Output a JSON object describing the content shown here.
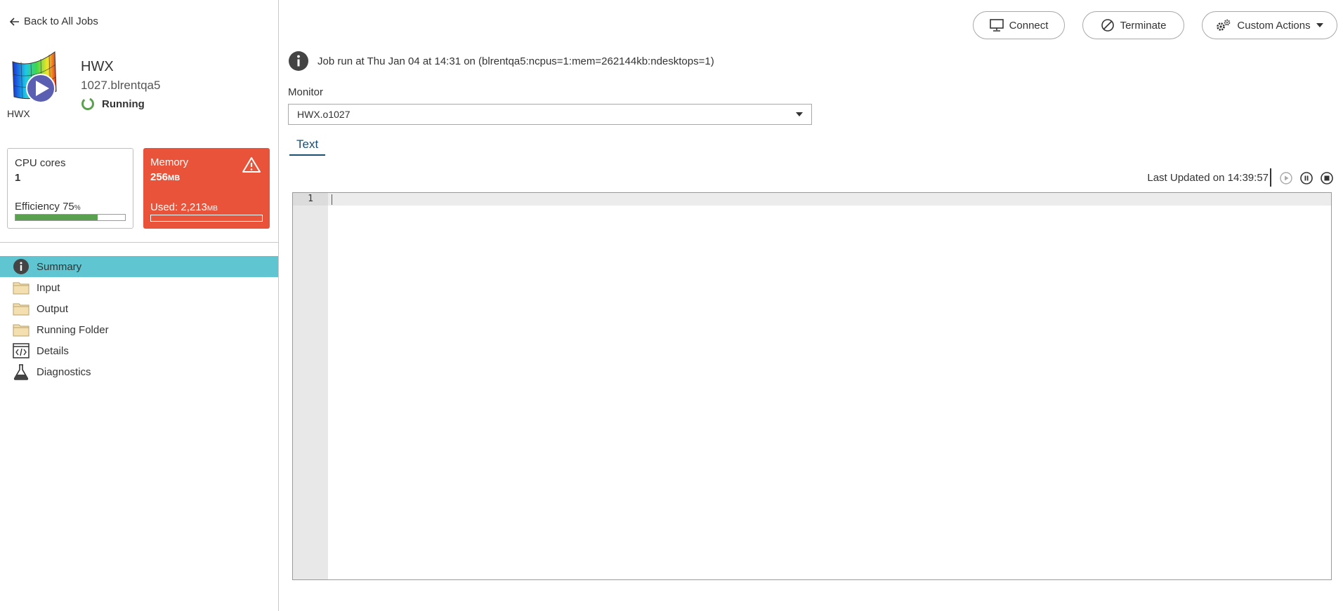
{
  "sidebar": {
    "back_label": "Back to All Jobs",
    "app_label": "HWX",
    "job_title": "HWX",
    "job_id": "1027.blrentqa5",
    "status": "Running",
    "cpu": {
      "label": "CPU cores",
      "value": "1",
      "efficiency_label": "Efficiency 75",
      "efficiency_unit": "%",
      "efficiency_fraction": 0.75
    },
    "memory": {
      "label": "Memory",
      "value": "256",
      "unit": "MB",
      "used_label": "Used: 2,213",
      "used_unit": "MB"
    },
    "nav": [
      {
        "label": "Summary",
        "icon": "info-icon",
        "active": true
      },
      {
        "label": "Input",
        "icon": "folder-icon"
      },
      {
        "label": "Output",
        "icon": "folder-icon"
      },
      {
        "label": "Running Folder",
        "icon": "folder-icon"
      },
      {
        "label": "Details",
        "icon": "code-icon"
      },
      {
        "label": "Diagnostics",
        "icon": "flask-icon"
      }
    ]
  },
  "toolbar": {
    "connect_label": "Connect",
    "terminate_label": "Terminate",
    "custom_actions_label": "Custom Actions"
  },
  "main": {
    "info_text": "Job run at Thu Jan 04 at 14:31 on (blrentqa5:ncpus=1:mem=262144kb:ndesktops=1)",
    "monitor_label": "Monitor",
    "monitor_value": "HWX.o1027",
    "tab_label": "Text",
    "last_updated": "Last Updated on 14:39:57",
    "editor_line": "1"
  },
  "colors": {
    "accent": "#5fc5d0",
    "memory_alert": "#e8533a",
    "efficiency_bar": "#5aa14f",
    "tab": "#1b4f72"
  }
}
